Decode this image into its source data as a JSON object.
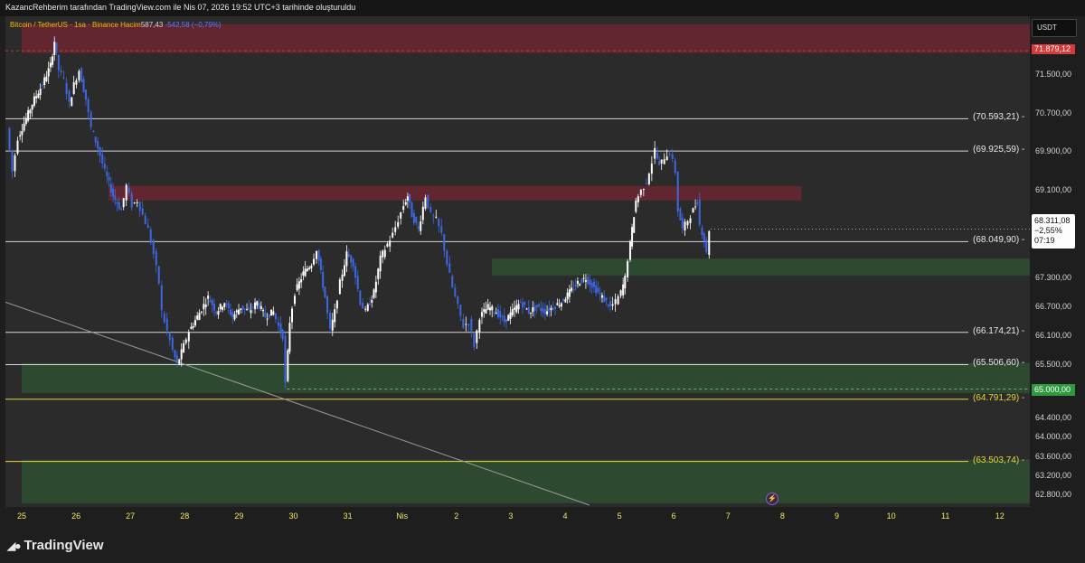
{
  "header": {
    "attribution": "KazancRehberim tarafından TradingView.com ile Nis 07, 2026 19:52 UTC+3 tarihinde oluşturuldu"
  },
  "legend": {
    "symbol": "Bitcoin / TetherUS · 1sa · Binance",
    "volume_label": "Hacim",
    "volume_value": "587,43",
    "change": "-542,58 (−0,79%)"
  },
  "currency": "USDT",
  "footer": {
    "brand": "TradingView"
  },
  "colors": {
    "background": "#1e1e1e",
    "plot_background": "#2b2b2b",
    "candle_up": "#ffffff",
    "candle_down": "#3d68e0",
    "resistance_zone": "#6b2630",
    "support_zone": "#2d4b2f",
    "level_white": "#d8d8d8",
    "level_yellow": "#e8d53a",
    "trendline": "#9a9a9a"
  },
  "chart_data": {
    "type": "candlestick",
    "timeframe": "1sa",
    "ylim": [
      62600,
      72600
    ],
    "x_axis": {
      "labels": [
        "25",
        "26",
        "27",
        "28",
        "29",
        "30",
        "31",
        "Nis",
        "2",
        "3",
        "4",
        "5",
        "6",
        "7",
        "8",
        "9",
        "10",
        "11",
        "12"
      ]
    },
    "y_axis": {
      "ticks": [
        62800,
        63200,
        63600,
        64000,
        64400,
        65500,
        66100,
        66700,
        67300,
        69100,
        69900,
        70700,
        71500
      ],
      "tick_labels": [
        "62.800,00",
        "63.200,00",
        "63.600,00",
        "64.000,00",
        "64.400,00",
        "65.500,00",
        "66.100,00",
        "66.700,00",
        "67.300,00",
        "69.100,00",
        "69.900,00",
        "70.700,00",
        "71.500,00"
      ]
    },
    "levels": [
      {
        "value": 70593.21,
        "label": "(70.593,21)",
        "color": "white"
      },
      {
        "value": 69925.59,
        "label": "(69.925,59)",
        "color": "white"
      },
      {
        "value": 68049.9,
        "label": "(68.049,90)",
        "color": "white"
      },
      {
        "value": 66174.21,
        "label": "(66.174,21)",
        "color": "white"
      },
      {
        "value": 65506.6,
        "label": "(65.506,60)",
        "color": "white"
      },
      {
        "value": 64791.29,
        "label": "(64.791,29)",
        "color": "yellow"
      },
      {
        "value": 63503.74,
        "label": "(63.503,74)",
        "color": "yellow"
      }
    ],
    "zones": [
      {
        "kind": "resistance",
        "from_x": 0,
        "to_x": 19.55,
        "y_low": 71950,
        "y_high": 72550
      },
      {
        "kind": "resistance",
        "from_x": 1.6,
        "to_x": 14.35,
        "y_low": 68900,
        "y_high": 69200
      },
      {
        "kind": "support",
        "from_x": 8.65,
        "to_x": 18.55,
        "y_low": 67350,
        "y_high": 67700
      },
      {
        "kind": "support",
        "from_x": 0,
        "to_x": 18.55,
        "y_low": 64920,
        "y_high": 65540
      },
      {
        "kind": "support",
        "from_x": 0,
        "to_x": 18.55,
        "y_low": 62640,
        "y_high": 63540
      }
    ],
    "trendline": {
      "from": {
        "x": -0.3,
        "y": 66800
      },
      "to": {
        "x": 10.45,
        "y": 62600
      }
    },
    "current_price": {
      "value": 68311.08,
      "label": "68.311,08",
      "change": "−2,55%",
      "countdown": "07:19"
    },
    "price_tags": [
      {
        "value": 65000,
        "label": "65.000,00",
        "color": "#2e9a40"
      },
      {
        "value": 72000,
        "label": "71.879,12",
        "color": "#d63a3a"
      }
    ],
    "price_path": [
      [
        -0.25,
        70400
      ],
      [
        -0.15,
        69500
      ],
      [
        -0.05,
        70200
      ],
      [
        0.1,
        70600
      ],
      [
        0.25,
        71000
      ],
      [
        0.4,
        71300
      ],
      [
        0.55,
        71700
      ],
      [
        0.62,
        72200
      ],
      [
        0.7,
        71600
      ],
      [
        0.8,
        71400
      ],
      [
        0.9,
        70900
      ],
      [
        0.98,
        71300
      ],
      [
        1.08,
        71600
      ],
      [
        1.2,
        71000
      ],
      [
        1.3,
        70400
      ],
      [
        1.42,
        70000
      ],
      [
        1.55,
        69500
      ],
      [
        1.7,
        69000
      ],
      [
        1.85,
        68700
      ],
      [
        1.95,
        69200
      ],
      [
        2.05,
        68800
      ],
      [
        2.15,
        68900
      ],
      [
        2.25,
        68600
      ],
      [
        2.35,
        68300
      ],
      [
        2.45,
        67800
      ],
      [
        2.55,
        67200
      ],
      [
        2.6,
        66600
      ],
      [
        2.7,
        66200
      ],
      [
        2.8,
        65800
      ],
      [
        2.88,
        65500
      ],
      [
        3.0,
        65900
      ],
      [
        3.1,
        66200
      ],
      [
        3.25,
        66500
      ],
      [
        3.45,
        66900
      ],
      [
        3.6,
        66600
      ],
      [
        3.75,
        66800
      ],
      [
        3.9,
        66500
      ],
      [
        4.05,
        66700
      ],
      [
        4.2,
        66600
      ],
      [
        4.35,
        66800
      ],
      [
        4.5,
        66500
      ],
      [
        4.65,
        66600
      ],
      [
        4.75,
        66300
      ],
      [
        4.82,
        66100
      ],
      [
        4.88,
        65100
      ],
      [
        4.95,
        66400
      ],
      [
        5.05,
        67000
      ],
      [
        5.2,
        67400
      ],
      [
        5.35,
        67600
      ],
      [
        5.45,
        67900
      ],
      [
        5.6,
        66900
      ],
      [
        5.7,
        66200
      ],
      [
        5.78,
        66600
      ],
      [
        5.88,
        67200
      ],
      [
        6.0,
        67800
      ],
      [
        6.12,
        67600
      ],
      [
        6.25,
        66800
      ],
      [
        6.35,
        66600
      ],
      [
        6.5,
        67000
      ],
      [
        6.62,
        67700
      ],
      [
        6.75,
        68000
      ],
      [
        6.85,
        68200
      ],
      [
        6.95,
        68500
      ],
      [
        7.05,
        68800
      ],
      [
        7.12,
        69000
      ],
      [
        7.2,
        68600
      ],
      [
        7.32,
        68300
      ],
      [
        7.45,
        69000
      ],
      [
        7.55,
        68600
      ],
      [
        7.65,
        68500
      ],
      [
        7.75,
        68200
      ],
      [
        7.85,
        67600
      ],
      [
        7.95,
        67100
      ],
      [
        8.05,
        66700
      ],
      [
        8.15,
        66300
      ],
      [
        8.25,
        66400
      ],
      [
        8.35,
        65900
      ],
      [
        8.45,
        66500
      ],
      [
        8.6,
        66700
      ],
      [
        8.75,
        66600
      ],
      [
        8.9,
        66400
      ],
      [
        9.05,
        66600
      ],
      [
        9.2,
        66800
      ],
      [
        9.35,
        66600
      ],
      [
        9.5,
        66700
      ],
      [
        9.65,
        66600
      ],
      [
        9.8,
        66700
      ],
      [
        9.95,
        66800
      ],
      [
        10.1,
        67000
      ],
      [
        10.25,
        67200
      ],
      [
        10.4,
        67300
      ],
      [
        10.55,
        67100
      ],
      [
        10.7,
        66900
      ],
      [
        10.85,
        66700
      ],
      [
        10.95,
        66800
      ],
      [
        11.05,
        67000
      ],
      [
        11.12,
        67300
      ],
      [
        11.18,
        67700
      ],
      [
        11.25,
        68300
      ],
      [
        11.32,
        68900
      ],
      [
        11.42,
        69100
      ],
      [
        11.52,
        69300
      ],
      [
        11.62,
        69700
      ],
      [
        11.68,
        69950
      ],
      [
        11.75,
        69600
      ],
      [
        11.85,
        69800
      ],
      [
        11.95,
        69900
      ],
      [
        12.05,
        69500
      ],
      [
        12.1,
        68700
      ],
      [
        12.18,
        68300
      ],
      [
        12.28,
        68500
      ],
      [
        12.38,
        68700
      ],
      [
        12.45,
        68900
      ],
      [
        12.5,
        68400
      ],
      [
        12.58,
        68100
      ],
      [
        12.62,
        67800
      ],
      [
        12.68,
        68311
      ]
    ]
  }
}
